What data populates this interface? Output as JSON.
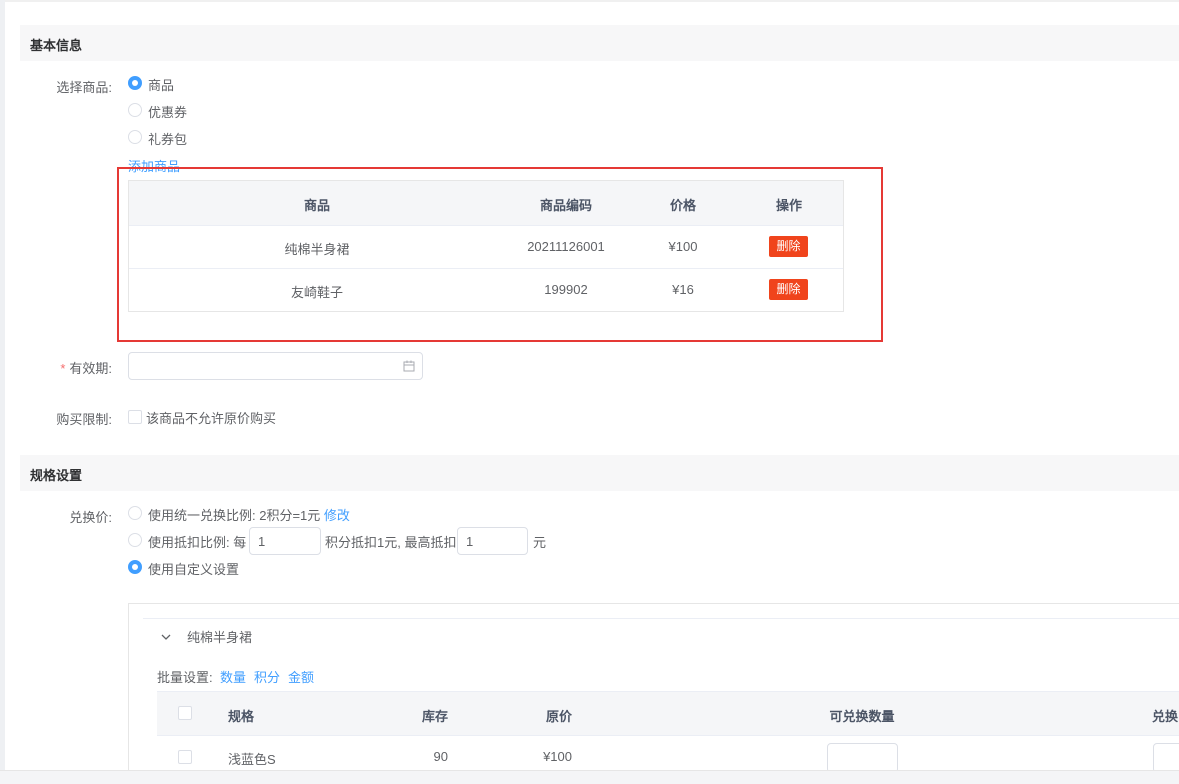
{
  "basic": {
    "section_title": "基本信息",
    "select_label": "选择商品:",
    "options": [
      "商品",
      "优惠券",
      "礼券包"
    ],
    "selected_index": 0,
    "add_link": "添加商品"
  },
  "product_table": {
    "headers": [
      "商品",
      "商品编码",
      "价格",
      "操作"
    ],
    "rows": [
      {
        "name": "纯棉半身裙",
        "code": "20211126001",
        "price": "¥100",
        "action": "删除"
      },
      {
        "name": "友崎鞋子",
        "code": "199902",
        "price": "¥16",
        "action": "删除"
      }
    ]
  },
  "validity": {
    "required_mark": "*",
    "label": "有效期:",
    "value": "",
    "icon": "calendar-icon"
  },
  "purchase": {
    "label": "购买限制:",
    "checkbox_text": "该商品不允许原价购买",
    "checked": false
  },
  "spec": {
    "section_title": "规格设置",
    "exchange_label": "兑换价:",
    "opt1_text": "使用统一兑换比例: 2积分=1元",
    "opt1_link": "修改",
    "opt2_prefix": "使用抵扣比例: 每",
    "opt2_value1": "1",
    "opt2_middle": "积分抵扣1元, 最高抵扣",
    "opt2_value2": "1",
    "opt2_suffix": "元",
    "opt3_text": "使用自定义设置",
    "selected_index": 2,
    "panel": {
      "collapse_icon": "chevron-down-icon",
      "title": "纯棉半身裙",
      "batch_label": "批量设置:",
      "batch_links": [
        "数量",
        "积分",
        "金额"
      ],
      "headers": [
        "规格",
        "库存",
        "原价",
        "可兑换数量",
        "兑换"
      ],
      "rows": [
        {
          "spec": "浅蓝色S",
          "stock": "90",
          "price": "¥100"
        }
      ]
    }
  },
  "colors": {
    "primary": "#409eff",
    "danger": "#f0441c",
    "highlight_frame": "#e53935"
  }
}
